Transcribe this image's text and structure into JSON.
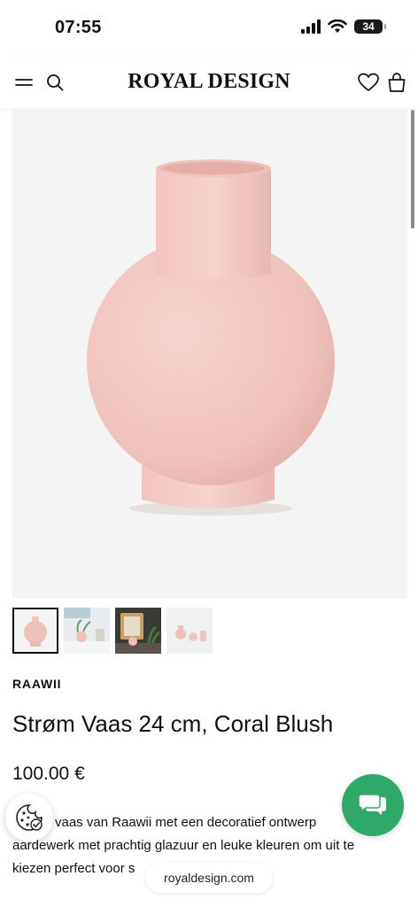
{
  "status_bar": {
    "time": "07:55",
    "battery": "34"
  },
  "header": {
    "logo": "ROYAL DESIGN",
    "menu_icon": "hamburger-menu-icon",
    "search_icon": "search-icon",
    "wishlist_icon": "heart-icon",
    "cart_icon": "shopping-bag-icon"
  },
  "product": {
    "brand": "RAAWII",
    "title": "Strøm Vaas 24 cm, Coral Blush",
    "price": "100.00 €",
    "description_line1": "vaas van Raawii met een decoratief ontwerp",
    "description_line2": "aardewerk met prachtig glazuur en leuke kleuren om uit te",
    "description_line3": "kiezen perfect voor s",
    "image_color": "#f2c9c4",
    "thumbnails": [
      {
        "name": "vase-front",
        "selected": true
      },
      {
        "name": "vase-shelf",
        "selected": false
      },
      {
        "name": "vase-mirror",
        "selected": false
      },
      {
        "name": "vase-collection",
        "selected": false
      }
    ]
  },
  "floating": {
    "cookie_icon": "cookie-settings-icon",
    "chat_icon": "chat-bubbles-icon",
    "url": "royaldesign.com"
  },
  "colors": {
    "accent_green": "#2fa969",
    "vase_pink": "#f2c9c4"
  }
}
